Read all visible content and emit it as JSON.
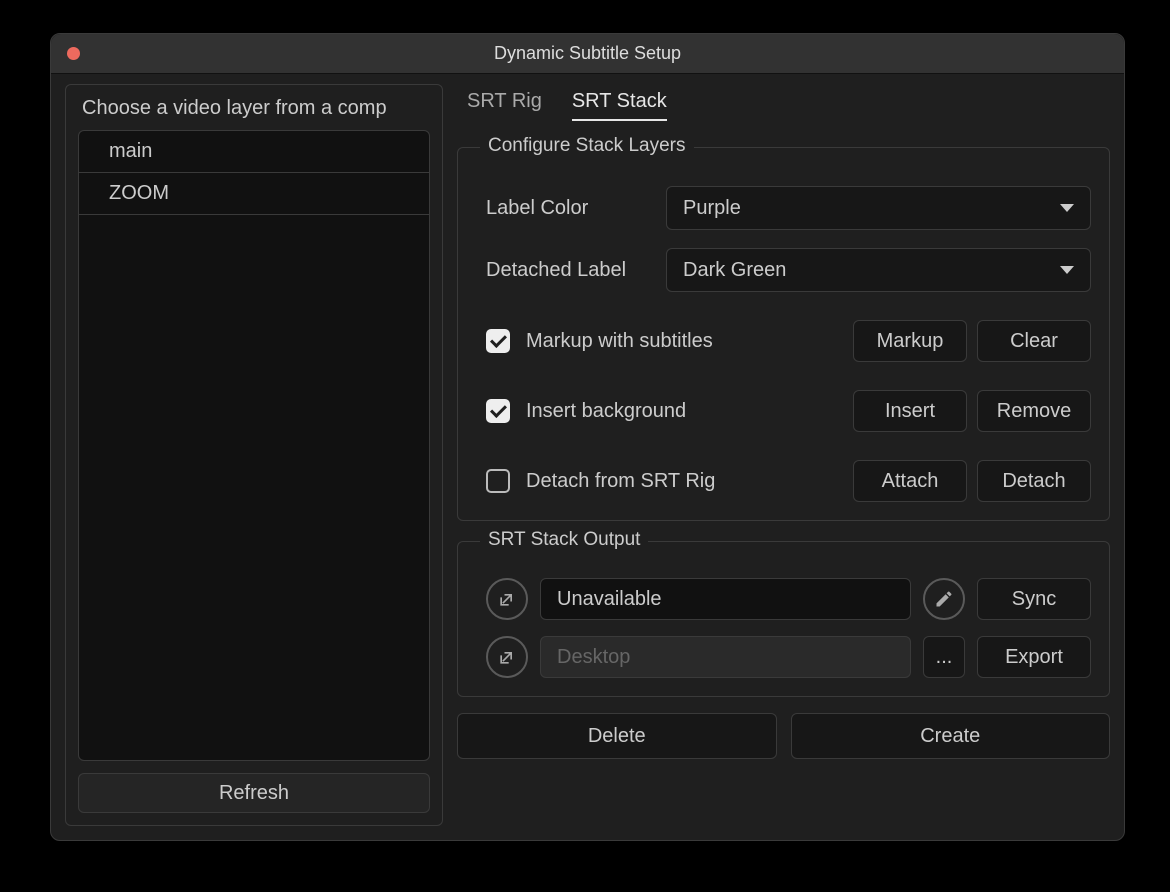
{
  "window": {
    "title": "Dynamic Subtitle Setup"
  },
  "left": {
    "title": "Choose a video layer from a comp",
    "items": [
      "main",
      "ZOOM"
    ],
    "refresh": "Refresh"
  },
  "tabs": [
    "SRT Rig",
    "SRT Stack"
  ],
  "active_tab": 1,
  "configure": {
    "title": "Configure Stack Layers",
    "label_color": {
      "label": "Label Color",
      "value": "Purple"
    },
    "detached_label": {
      "label": "Detached Label",
      "value": "Dark Green"
    },
    "markup": {
      "checked": true,
      "label": "Markup with subtitles",
      "btn1": "Markup",
      "btn2": "Clear"
    },
    "insert_bg": {
      "checked": true,
      "label": "Insert background",
      "btn1": "Insert",
      "btn2": "Remove"
    },
    "detach": {
      "checked": false,
      "label": "Detach from SRT Rig",
      "btn1": "Attach",
      "btn2": "Detach"
    }
  },
  "output": {
    "title": "SRT Stack Output",
    "row1": {
      "text": "Unavailable",
      "action": "Sync"
    },
    "row2": {
      "text": "Desktop",
      "browse": "...",
      "action": "Export"
    }
  },
  "bottom": {
    "delete": "Delete",
    "create": "Create"
  }
}
